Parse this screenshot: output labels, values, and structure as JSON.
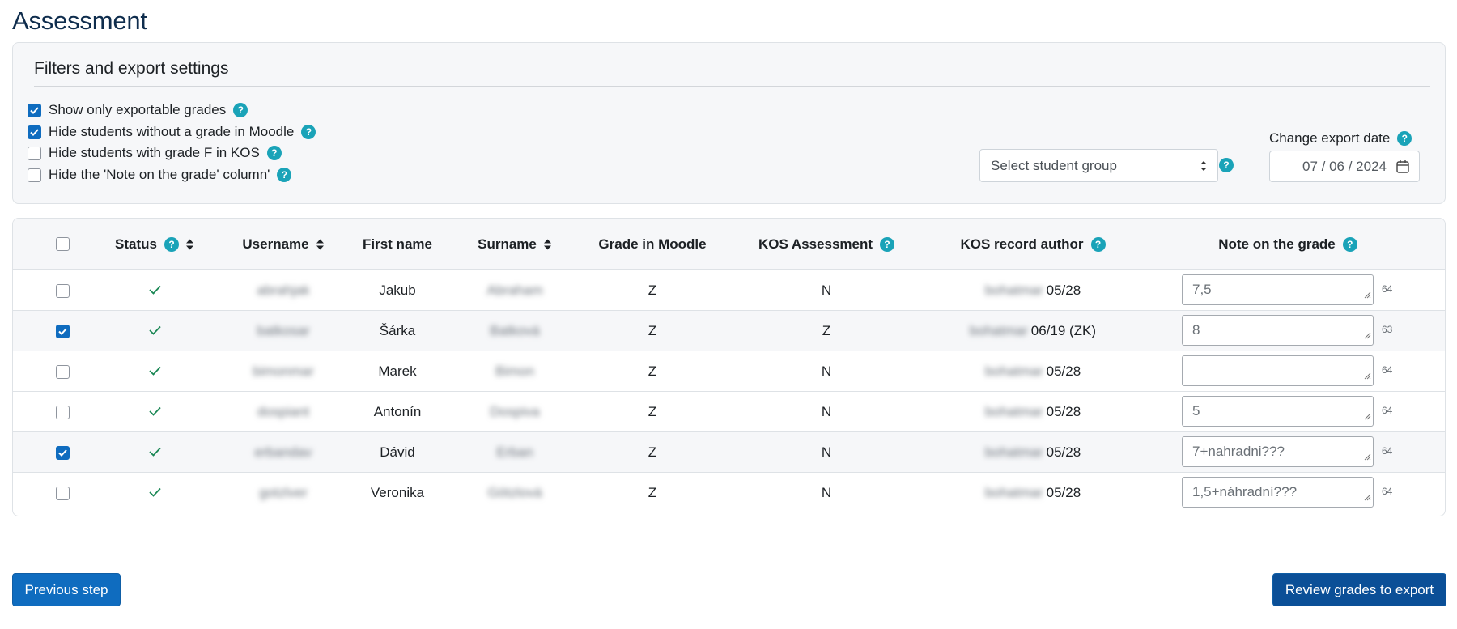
{
  "page": {
    "title": "Assessment"
  },
  "filters": {
    "title": "Filters and export settings",
    "options": [
      {
        "label": "Show only exportable grades",
        "checked": true
      },
      {
        "label": "Hide students without a grade in Moodle",
        "checked": true
      },
      {
        "label": "Hide students with grade F in KOS",
        "checked": false
      },
      {
        "label": "Hide the 'Note on the grade' column'",
        "checked": false
      }
    ],
    "group_select": {
      "placeholder": "Select student group"
    },
    "export_date": {
      "label": "Change export date",
      "value": "07 / 06 / 2024"
    }
  },
  "table": {
    "headers": {
      "status": "Status",
      "username": "Username",
      "first_name": "First name",
      "surname": "Surname",
      "grade_moodle": "Grade in Moodle",
      "kos_assessment": "KOS Assessment",
      "kos_author": "KOS record author",
      "note": "Note on the grade"
    },
    "rows": [
      {
        "selected": false,
        "status": "✓",
        "username": "abrahjak",
        "first_name": "Jakub",
        "surname": "Abraham",
        "grade": "Z",
        "kos": "N",
        "author": "bohatmar",
        "author_date": "05/28",
        "note": "7,5",
        "counter": "64"
      },
      {
        "selected": true,
        "status": "✓",
        "username": "batkosar",
        "first_name": "Šárka",
        "surname": "Batková",
        "grade": "Z",
        "kos": "Z",
        "author": "bohatmar",
        "author_date": "06/19 (ZK)",
        "note": "8",
        "counter": "63"
      },
      {
        "selected": false,
        "status": "✓",
        "username": "bimonmar",
        "first_name": "Marek",
        "surname": "Bimon",
        "grade": "Z",
        "kos": "N",
        "author": "bohatmar",
        "author_date": "05/28",
        "note": "",
        "counter": "64"
      },
      {
        "selected": false,
        "status": "✓",
        "username": "dospiant",
        "first_name": "Antonín",
        "surname": "Dospiva",
        "grade": "Z",
        "kos": "N",
        "author": "bohatmar",
        "author_date": "05/28",
        "note": "5",
        "counter": "64"
      },
      {
        "selected": true,
        "status": "✓",
        "username": "erbandav",
        "first_name": "Dávid",
        "surname": "Erban",
        "grade": "Z",
        "kos": "N",
        "author": "bohatmar",
        "author_date": "05/28",
        "note": "7+nahradni???",
        "counter": "64"
      },
      {
        "selected": false,
        "status": "✓",
        "username": "gotzlver",
        "first_name": "Veronika",
        "surname": "Götzlová",
        "grade": "Z",
        "kos": "N",
        "author": "bohatmar",
        "author_date": "05/28",
        "note": "1,5+náhradní???",
        "counter": "64"
      }
    ]
  },
  "buttons": {
    "previous": "Previous step",
    "review": "Review grades to export"
  },
  "colors": {
    "primary": "#0f6cbf",
    "help": "#1aa3b8",
    "success": "#198754"
  }
}
